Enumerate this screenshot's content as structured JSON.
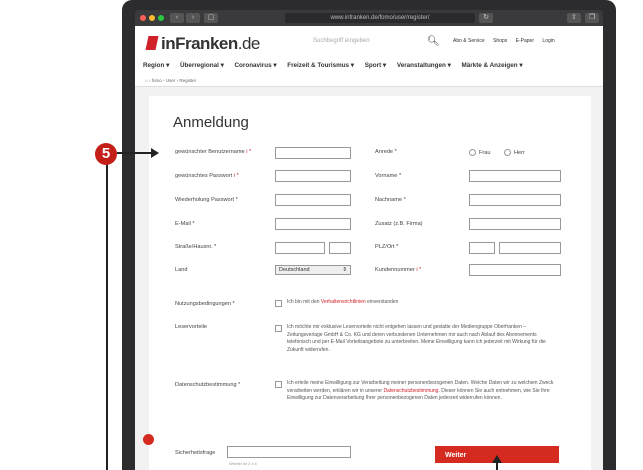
{
  "browser": {
    "url": "www.infranken.de/fomo/user/register/"
  },
  "header": {
    "logo_prefix": "inFranken",
    "logo_suffix": ".de",
    "search_placeholder": "Suchbegriff eingeben",
    "top_links": [
      "Abo & Service",
      "Shops",
      "E-Paper",
      "Login"
    ]
  },
  "nav": {
    "items": [
      "Region ▾",
      "Überregional ▾",
      "Coronavirus ▾",
      "Freizeit & Tourismus ▾",
      "Sport ▾",
      "Veranstaltungen ▾",
      "Märkte & Anzeigen ▾"
    ]
  },
  "breadcrumb": {
    "items": [
      "⌂",
      "›",
      "fomo",
      "›",
      "User",
      "›",
      "Register"
    ]
  },
  "form": {
    "title": "Anmeldung",
    "labels": {
      "username": "gewünschter Benutzername",
      "password": "gewünschtes Passwort",
      "password_repeat": "Wiederholung Passwort *",
      "email": "E-Mail *",
      "street": "Straße/Hausnr. *",
      "country": "Land",
      "salutation": "Anrede *",
      "firstname": "Vorname *",
      "lastname": "Nachname *",
      "addition": "Zusatz (z.B. Firma)",
      "zip_city": "PLZ/Ort *",
      "customer_no": "Kundennummer",
      "terms": "Nutzungsbedingungen *",
      "benefits": "Leservorteile",
      "privacy": "Datenschutzbestimmung *",
      "security": "Sicherheitsfrage"
    },
    "radio_frau": "Frau",
    "radio_herr": "Herr",
    "country_value": "Deutschland",
    "terms_text_before": "Ich bin mit den ",
    "terms_link": "Verhaltensrichtlinien",
    "terms_text_after": " einverstanden",
    "benefits_text": "Ich möchte mir exklusive Leservorteile nicht entgehen lassen und gestatte der Mediengruppe Oberfranken – Zeitungsverlage GmbH & Co. KG und deren verbundenen Unternehmen mir auch nach Ablauf des Abonnements telefonisch und per E-Mail Vorteilsangebote zu unterbreiten. Meine Einwilligung kann ich jederzeit mit Wirkung für die Zukunft widerrufen.",
    "privacy_text_before": "Ich erteile meine Einwilligung zur Verarbeitung meiner personenbezogenen Daten. Welche Daten wir zu welchem Zweck verarbeiten werden, erklären wir in unserer ",
    "privacy_link": "Datenschutzbestimmung",
    "privacy_text_after": ". Dieser können Sie auch entnehmen, wie Sie Ihre Einwilligung zur Datenverarbeitung Ihrer personenbezogenen Daten jederzeit widerrufen können.",
    "security_hint": "Wieviel ist 2 x 4",
    "submit_label": "Weiter"
  },
  "annotation": {
    "number": "5"
  }
}
